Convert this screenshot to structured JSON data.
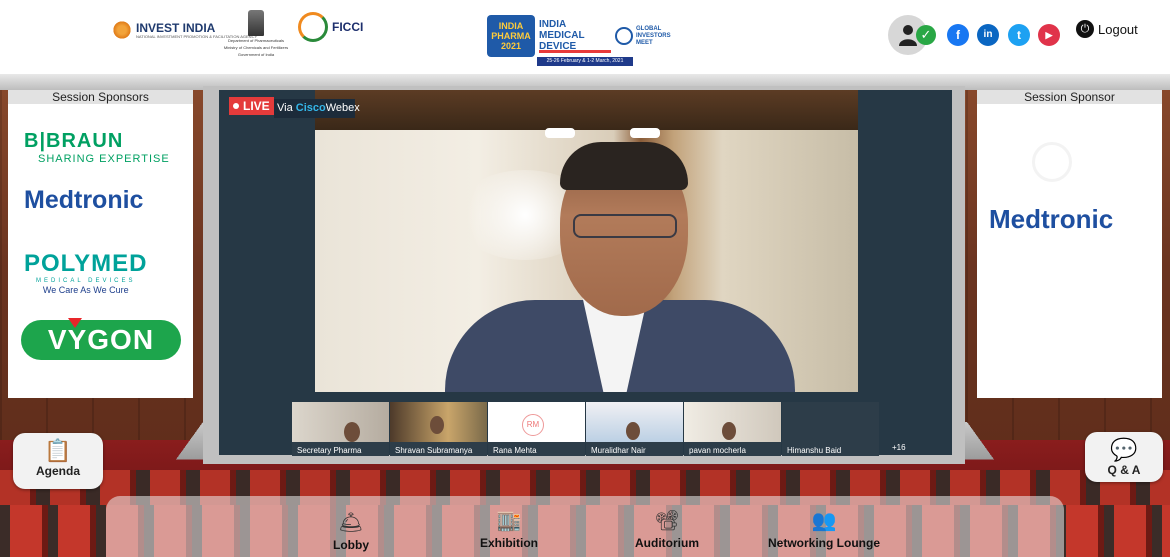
{
  "header": {
    "invest_india": {
      "title": "INVEST INDIA",
      "subtitle": "NATIONAL INVESTMENT PROMOTION & FACILITATION AGENCY"
    },
    "dop": {
      "line1": "Department of Pharmaceuticals",
      "line2": "Ministry of Chemicals and Fertilizers",
      "line3": "Government of India"
    },
    "ficci": "FICCI",
    "event": {
      "india_pharma": "INDIA PHARMA 2021",
      "india_medical_device": "INDIA MEDICAL DEVICE",
      "global_investors": "GLOBAL INVESTORS MEET",
      "dates": "25-26 February & 1-2 March, 2021"
    },
    "logout_label": "Logout"
  },
  "social": {
    "facebook": "f",
    "linkedin": "in",
    "twitter": "t",
    "youtube": "▶"
  },
  "sponsors_left": {
    "title": "Session Sponsors",
    "bbraun_line1": "B|BRAUN",
    "bbraun_line2": "SHARING EXPERTISE",
    "medtronic": "Medtronic",
    "polymed_line1": "POLYMED",
    "polymed_line2": "MEDICAL DEVICES",
    "polymed_line3": "We Care As We Cure",
    "vygon": "VYGON"
  },
  "sponsors_right": {
    "title": "Session Sponsor",
    "medtronic": "Medtronic"
  },
  "stream": {
    "live_label": "LIVE",
    "via_prefix": "Via ",
    "via_brand": "Cisco",
    "via_suffix": "Webex"
  },
  "participants": [
    {
      "name": "Secretary Pharma"
    },
    {
      "name": "Shravan Subramanya"
    },
    {
      "name": "Rana Mehta",
      "initials": "RM"
    },
    {
      "name": "Muralidhar Nair"
    },
    {
      "name": "pavan mocherla"
    },
    {
      "name": "Himanshu Baid"
    }
  ],
  "more_participants": "+16",
  "side_buttons": {
    "agenda": "Agenda",
    "qa": "Q & A"
  },
  "bottom_nav": {
    "lobby": "Lobby",
    "exhibition": "Exhibition",
    "auditorium": "Auditorium",
    "networking": "Networking Lounge"
  },
  "colors": {
    "live": "#e43b3b",
    "webex": "#35b6e8",
    "online": "#29a745"
  }
}
